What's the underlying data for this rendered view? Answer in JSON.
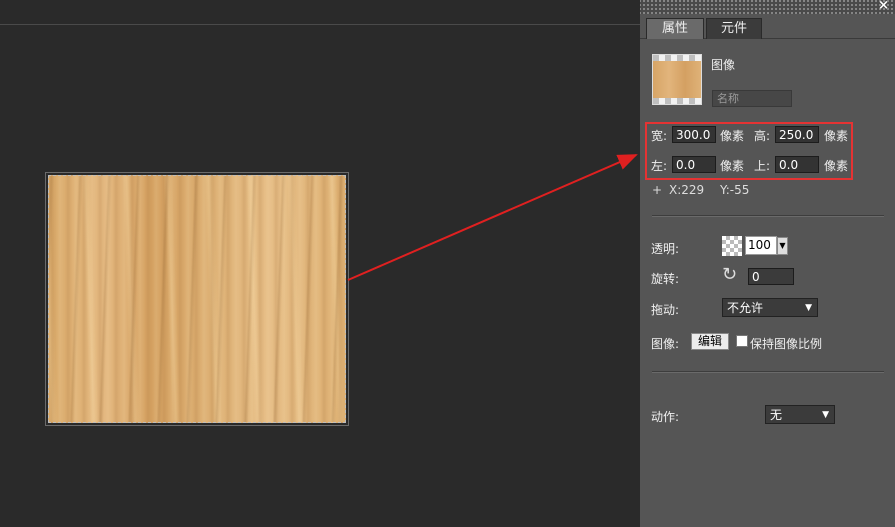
{
  "panel": {
    "close_glyph": "×",
    "tabs": [
      {
        "label": "属性",
        "active": true
      },
      {
        "label": "元件",
        "active": false
      }
    ],
    "image_label": "图像",
    "name_placeholder": "名称",
    "size": {
      "width_label": "宽:",
      "width_value": "300.0",
      "height_label": "高:",
      "height_value": "250.0",
      "unit": "像素"
    },
    "position": {
      "left_label": "左:",
      "left_value": "0.0",
      "top_label": "上:",
      "top_value": "0.0",
      "unit": "像素"
    },
    "coords": {
      "plus": "+",
      "x": "X:229",
      "y": "Y:-55"
    },
    "opacity": {
      "label": "透明:",
      "value": "100"
    },
    "rotation": {
      "label": "旋转:",
      "value": "0"
    },
    "drag": {
      "label": "拖动:",
      "value": "不允许"
    },
    "image_edit": {
      "label": "图像:",
      "button": "编辑",
      "keep_ratio_label": "保持图像比例"
    },
    "action": {
      "label": "动作:",
      "value": "无"
    }
  },
  "colors": {
    "highlight_box": "#e53333",
    "arrow": "#e02020"
  },
  "icons": [
    "close-icon",
    "rotate-icon",
    "dropdown-arrow-icon",
    "transparency-checker-icon"
  ]
}
